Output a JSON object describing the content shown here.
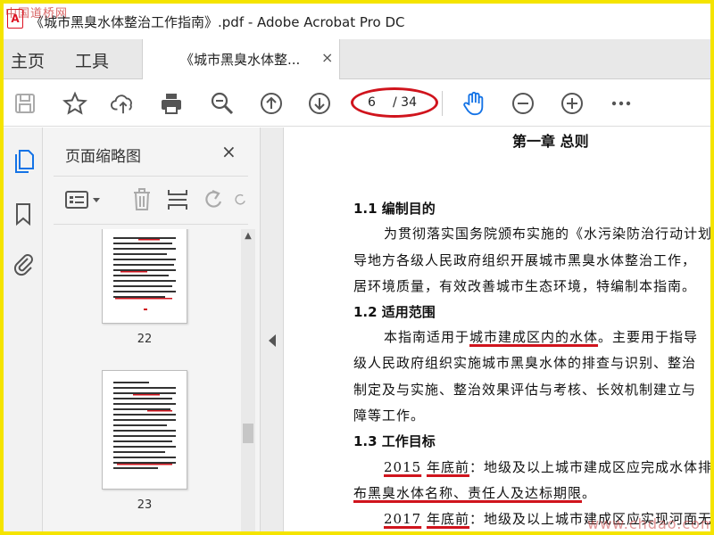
{
  "window": {
    "title": "《城市黑臭水体整治工作指南》.pdf - Adobe Acrobat Pro DC",
    "app_icon": "A"
  },
  "watermarks": {
    "top_left": "中国道桥网",
    "bottom_right": "www.chdao.com"
  },
  "tabs": {
    "home": "主页",
    "tools": "工具",
    "document": "《城市黑臭水体整...",
    "close": "×"
  },
  "toolbar": {
    "icons": [
      "save-icon",
      "star-icon",
      "cloud-upload-icon",
      "print-icon",
      "zoom-search-icon",
      "page-up-icon",
      "page-down-icon",
      "hand-tool-icon",
      "zoom-out-icon",
      "zoom-in-icon",
      "more-icon"
    ],
    "current_page": "6",
    "total_pages": "/ 34",
    "highlight_color": "#d0141d"
  },
  "left_rail": {
    "icons": [
      "page-thumbnails-icon",
      "bookmark-icon",
      "attachment-icon"
    ],
    "active_color": "#1473e6"
  },
  "thumbnails_panel": {
    "title": "页面缩略图",
    "close": "×",
    "tools": [
      "options-icon",
      "delete-icon",
      "insert-page-icon",
      "undo-icon"
    ],
    "pages": [
      {
        "label": "22"
      },
      {
        "label": "23"
      }
    ]
  },
  "document": {
    "chapter": "第一章  总则",
    "sections": [
      {
        "heading": "1.1  编制目的"
      },
      {
        "heading": "1.2  适用范围"
      },
      {
        "heading": "1.3  工作目标"
      }
    ],
    "lines": {
      "s1_l1": "为贯彻落实国务院颁布实施的《水污染防治行动计划",
      "s1_l2": "导地方各级人民政府组织开展城市黑臭水体整治工作，",
      "s1_l3": "居环境质量，有效改善城市生态环境，特编制本指南。",
      "s2_l1_a": "本指南适用于",
      "s2_l1_b": "城市建成区内的水体",
      "s2_l1_c": "。主要用于指导",
      "s2_l2": "级人民政府组织实施城市黑臭水体的排查与识别、整治",
      "s2_l3": "制定及与实施、整治效果评估与考核、长效机制建立与",
      "s2_l4": "障等工作。",
      "s3_l1_a": "2015",
      "s3_l1_b": "年底前",
      "s3_l1_c": "：地级及以上城市建成区应完成水体排",
      "s3_l2": "布黑臭水体名称、责任人及达标期限",
      "s3_l2_end": "。",
      "s3_l3_a": "2017",
      "s3_l3_b": "年底前",
      "s3_l3_c": "：地级及以上城市建成区应实现河面无"
    }
  }
}
